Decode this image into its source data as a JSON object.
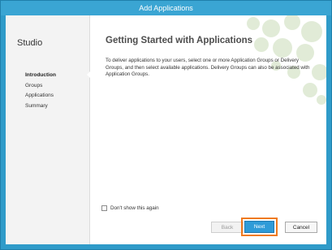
{
  "window": {
    "title": "Add Applications"
  },
  "sidebar": {
    "title": "Studio",
    "items": [
      {
        "label": "Introduction",
        "active": true
      },
      {
        "label": "Groups",
        "active": false
      },
      {
        "label": "Applications",
        "active": false
      },
      {
        "label": "Summary",
        "active": false
      }
    ]
  },
  "main": {
    "title": "Getting Started with Applications",
    "description": "To deliver applications to your users, select one or more Application Groups or Delivery Groups, and then select available applications. Delivery Groups can also be associated with Application Groups."
  },
  "footer": {
    "dont_show_label": "Don't show this again",
    "dont_show_checked": false,
    "back_label": "Back",
    "next_label": "Next",
    "cancel_label": "Cancel"
  },
  "colors": {
    "title_bar": "#3aa5d3",
    "primary_button": "#2f9bd8",
    "highlight": "#f07a1e",
    "decor_green": "#c9dcb8"
  },
  "icons": [
    "decorative-circles-pattern"
  ]
}
